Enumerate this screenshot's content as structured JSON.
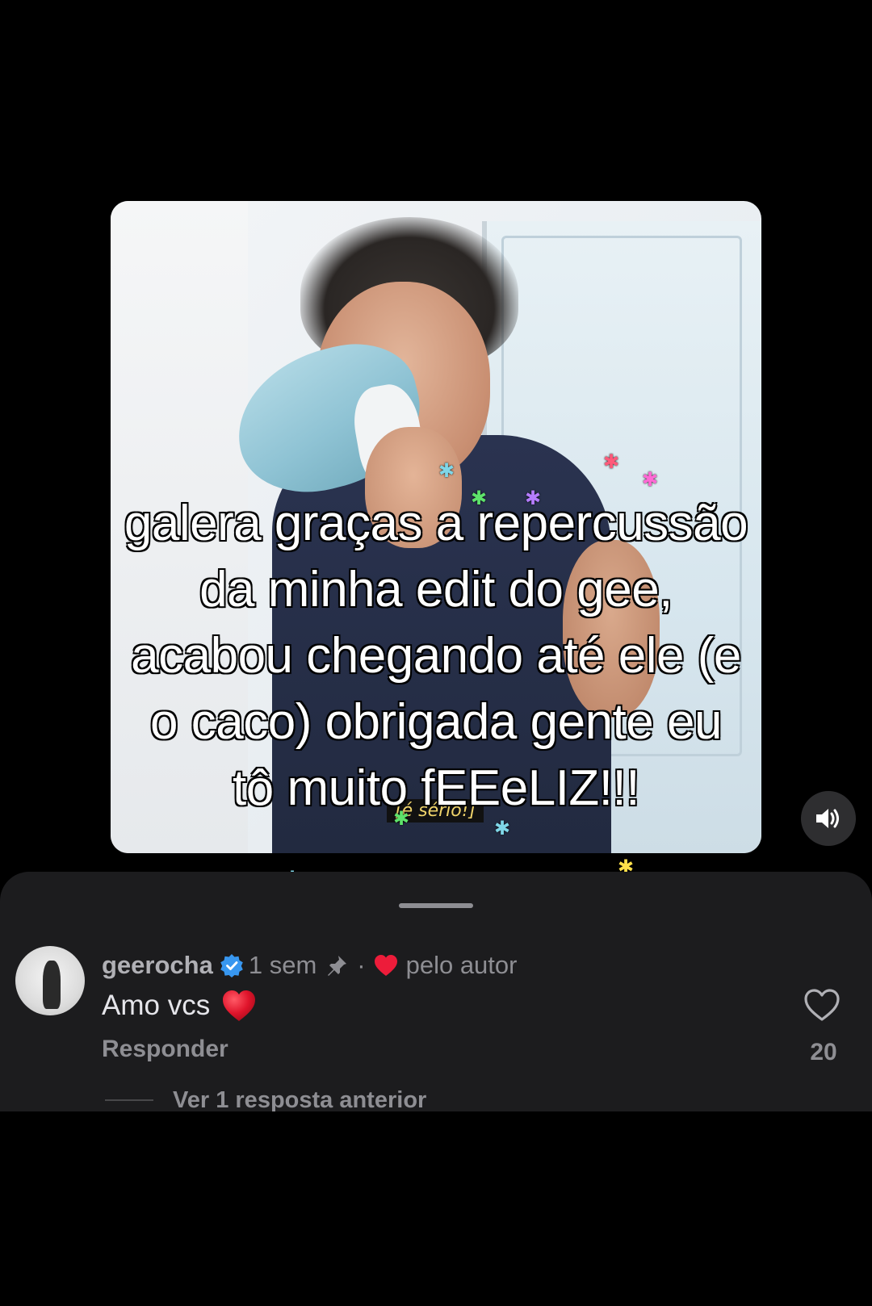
{
  "caption": {
    "line1": "galera graças a repercussão",
    "line2": "da minha edit do gee,",
    "line3": "acabou chegando até ele (e",
    "line4": "o caco) obrigada gente eu",
    "line5": "tô muito fEEeLIZ!!!"
  },
  "video": {
    "subtitle_text": "[é sério!]",
    "volume_icon": "speaker-volume-icon"
  },
  "comment": {
    "username": "geerocha",
    "verified_icon": "verified-badge-icon",
    "time_ago": "1 sem",
    "pin_icon": "pin-icon",
    "separator": "·",
    "liked_by_author_icon": "red-heart-icon",
    "liked_by_author_text": "pelo autor",
    "text": "Amo vcs",
    "emoji": "red-heart-emoji",
    "reply_label": "Responder",
    "like_count": "20",
    "view_replies_label": "Ver 1 resposta anterior"
  },
  "colors": {
    "background": "#000000",
    "sheet": "#1c1c1e",
    "muted_text": "#8e8e93",
    "verified_blue": "#3897f0",
    "heart_red": "#ed1c3a"
  }
}
